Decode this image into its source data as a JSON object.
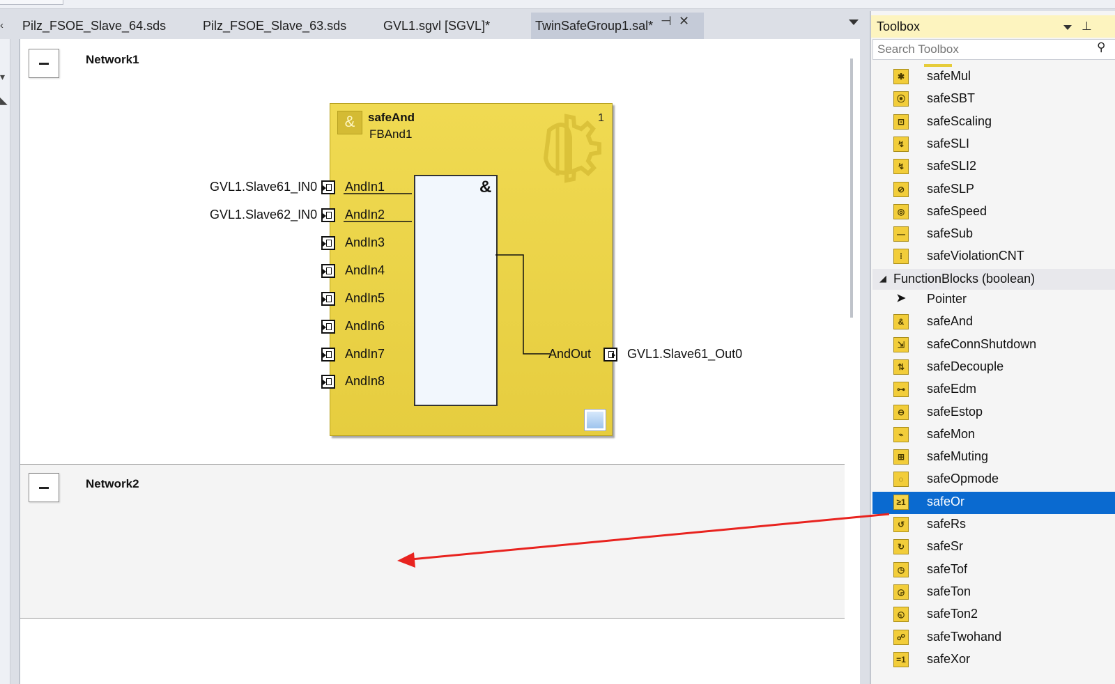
{
  "tabs": [
    {
      "label": "Pilz_FSOE_Slave_64.sds",
      "active": false
    },
    {
      "label": "Pilz_FSOE_Slave_63.sds",
      "active": false
    },
    {
      "label": "GVL1.sgvl [SGVL]*",
      "active": false
    },
    {
      "label": "TwinSafeGroup1.sal*",
      "active": true
    }
  ],
  "editor": {
    "networks": [
      {
        "title": "Network1"
      },
      {
        "title": "Network2"
      }
    ],
    "function_block": {
      "type_name": "safeAnd",
      "instance_name": "FBAnd1",
      "number": "1",
      "operator_symbol": "&",
      "inputs": [
        {
          "pin": "AndIn1",
          "variable": "GVL1.Slave61_IN0"
        },
        {
          "pin": "AndIn2",
          "variable": "GVL1.Slave62_IN0"
        },
        {
          "pin": "AndIn3",
          "variable": ""
        },
        {
          "pin": "AndIn4",
          "variable": ""
        },
        {
          "pin": "AndIn5",
          "variable": ""
        },
        {
          "pin": "AndIn6",
          "variable": ""
        },
        {
          "pin": "AndIn7",
          "variable": ""
        },
        {
          "pin": "AndIn8",
          "variable": ""
        }
      ],
      "output": {
        "pin": "AndOut",
        "variable": "GVL1.Slave61_Out0"
      }
    }
  },
  "toolbox": {
    "title": "Toolbox",
    "search_placeholder": "Search Toolbox",
    "items_top": [
      {
        "label": "safeMul",
        "icon": "multiply-icon",
        "glyph": "✱"
      },
      {
        "label": "safeSBT",
        "icon": "sbt-icon",
        "glyph": "⦿"
      },
      {
        "label": "safeScaling",
        "icon": "scaling-icon",
        "glyph": "⊡"
      },
      {
        "label": "safeSLI",
        "icon": "sli-icon",
        "glyph": "↯"
      },
      {
        "label": "safeSLI2",
        "icon": "sli2-icon",
        "glyph": "↯"
      },
      {
        "label": "safeSLP",
        "icon": "slp-icon",
        "glyph": "⊘"
      },
      {
        "label": "safeSpeed",
        "icon": "speed-icon",
        "glyph": "◎"
      },
      {
        "label": "safeSub",
        "icon": "minus-icon",
        "glyph": "—"
      },
      {
        "label": "safeViolationCNT",
        "icon": "violation-counter-icon",
        "glyph": "⁞"
      }
    ],
    "group_label": "FunctionBlocks (boolean)",
    "items_group": [
      {
        "label": "Pointer",
        "icon": "pointer-icon",
        "glyph": "➤",
        "selected": false
      },
      {
        "label": "safeAnd",
        "icon": "and-icon",
        "glyph": "&",
        "selected": false
      },
      {
        "label": "safeConnShutdown",
        "icon": "conn-shutdown-icon",
        "glyph": "⇲",
        "selected": false
      },
      {
        "label": "safeDecouple",
        "icon": "decouple-icon",
        "glyph": "⇅",
        "selected": false
      },
      {
        "label": "safeEdm",
        "icon": "edm-icon",
        "glyph": "⊶",
        "selected": false
      },
      {
        "label": "safeEstop",
        "icon": "estop-icon",
        "glyph": "⊖",
        "selected": false
      },
      {
        "label": "safeMon",
        "icon": "monitor-icon",
        "glyph": "⌁",
        "selected": false
      },
      {
        "label": "safeMuting",
        "icon": "muting-icon",
        "glyph": "⊞",
        "selected": false
      },
      {
        "label": "safeOpmode",
        "icon": "opmode-icon",
        "glyph": "◌",
        "selected": false
      },
      {
        "label": "safeOr",
        "icon": "or-icon",
        "glyph": "≥1",
        "selected": true
      },
      {
        "label": "safeRs",
        "icon": "rs-flipflop-icon",
        "glyph": "↺",
        "selected": false
      },
      {
        "label": "safeSr",
        "icon": "sr-flipflop-icon",
        "glyph": "↻",
        "selected": false
      },
      {
        "label": "safeTof",
        "icon": "timer-off-icon",
        "glyph": "◷",
        "selected": false
      },
      {
        "label": "safeTon",
        "icon": "timer-on-icon",
        "glyph": "◶",
        "selected": false
      },
      {
        "label": "safeTon2",
        "icon": "timer-on2-icon",
        "glyph": "◵",
        "selected": false
      },
      {
        "label": "safeTwohand",
        "icon": "twohand-icon",
        "glyph": "☍",
        "selected": false
      },
      {
        "label": "safeXor",
        "icon": "xor-icon",
        "glyph": "=1",
        "selected": false
      }
    ]
  },
  "annotation": {
    "arrow_color": "#e8231f"
  },
  "colors": {
    "selection": "#0a6ad0",
    "block_fill": "#e6cd3f"
  }
}
